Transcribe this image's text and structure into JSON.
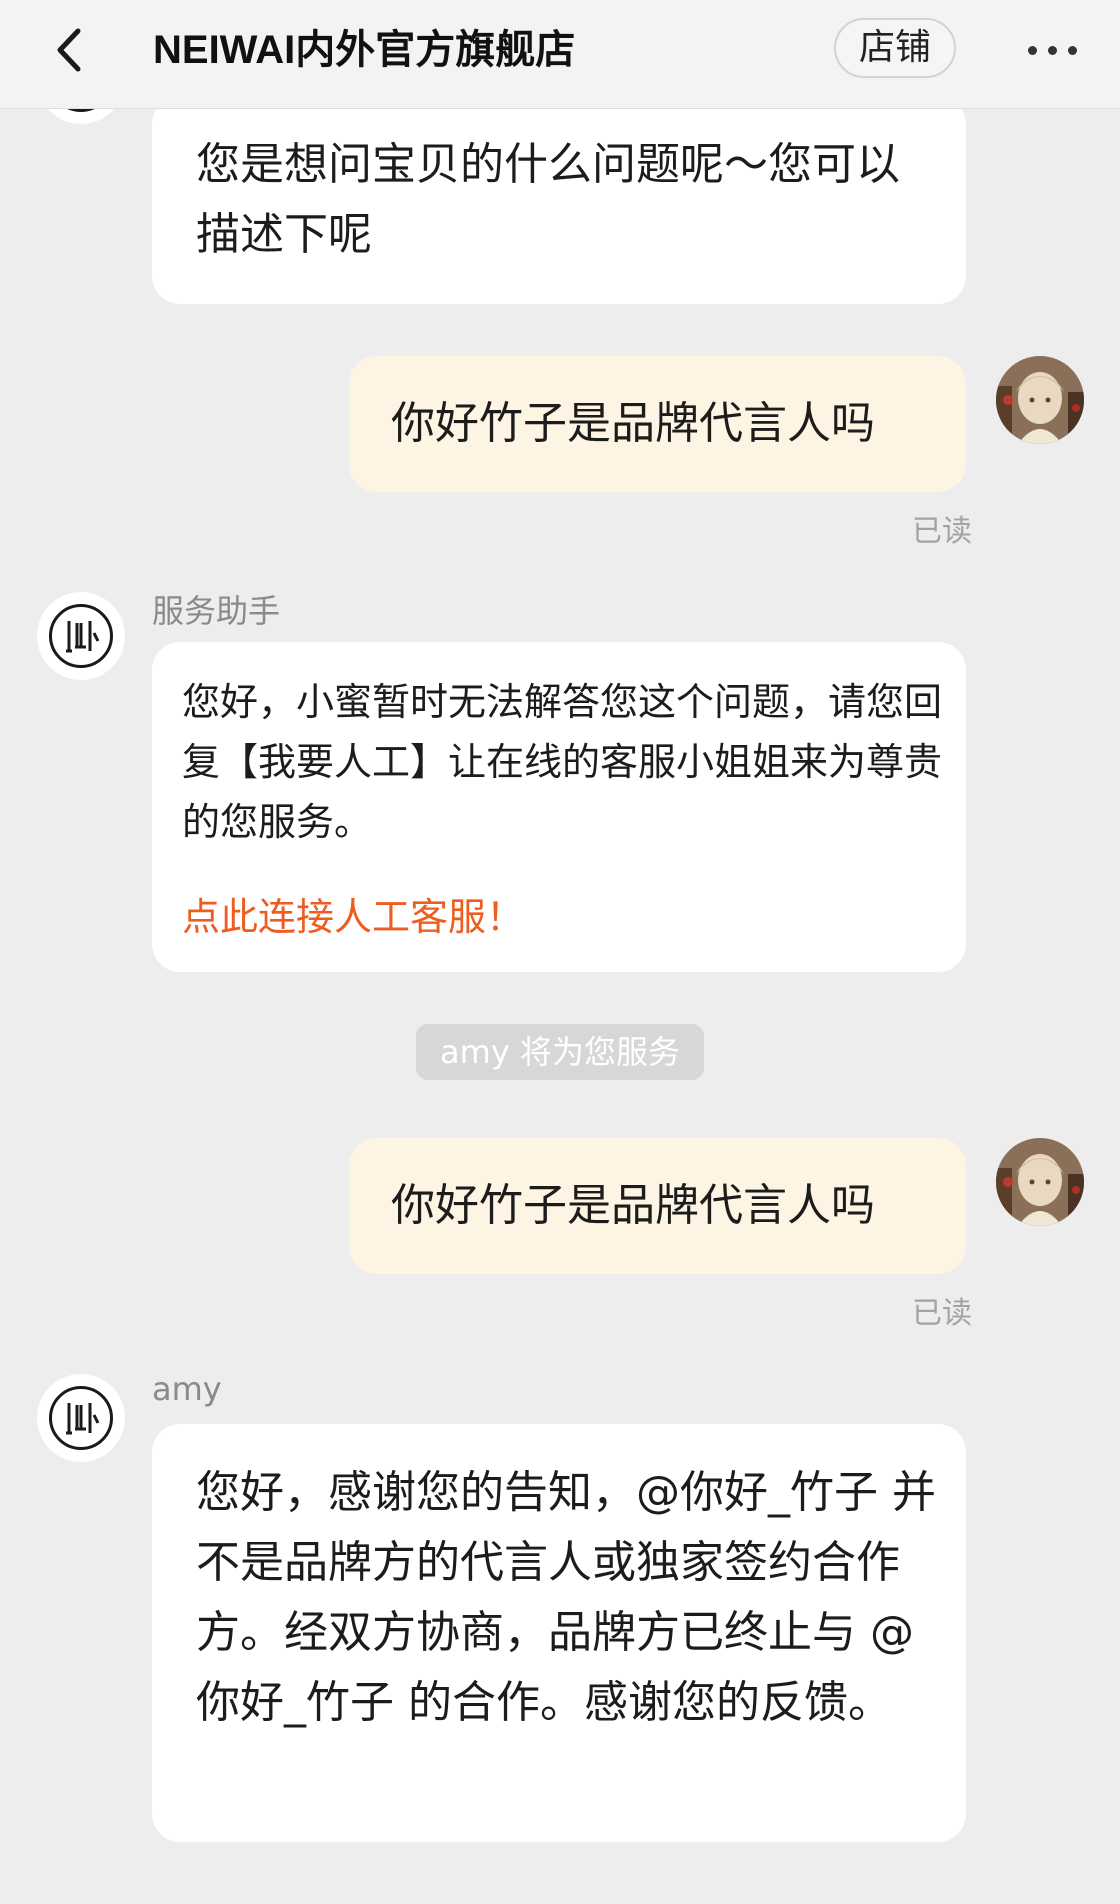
{
  "header": {
    "shop_name": "NEIWAI内外官方旗舰店",
    "store_button": "店铺"
  },
  "messages": [
    {
      "sender": "shop",
      "text": "您是想问宝贝的什么问题呢～您可以描述下呢"
    },
    {
      "sender": "user",
      "text": "你好竹子是品牌代言人吗",
      "status": "已读"
    },
    {
      "sender": "shop",
      "name": "服务助手",
      "text": "您好，小蜜暂时无法解答您这个问题，请您回复【我要人工】让在线的客服小姐姐来为尊贵的您服务。",
      "link": "点此连接人工客服！"
    },
    {
      "sender": "system",
      "text": "amy 将为您服务"
    },
    {
      "sender": "user",
      "text": "你好竹子是品牌代言人吗",
      "status": "已读"
    },
    {
      "sender": "shop",
      "name": "amy",
      "text": "您好，感谢您的告知，@你好_竹子 并不是品牌方的代言人或独家签约合作方。经双方协商，品牌方已终止与 @你好_竹子 的合作。感谢您的反馈。"
    }
  ],
  "icons": [
    "chevron-left-icon",
    "more-icon",
    "neiwai-logo",
    "user-avatar"
  ],
  "colors": {
    "background": "#ededed",
    "shop_bubble": "#ffffff",
    "user_bubble": "#fdf4e4",
    "link": "#ee5d1f",
    "system_pill": "#d7d7d7"
  }
}
